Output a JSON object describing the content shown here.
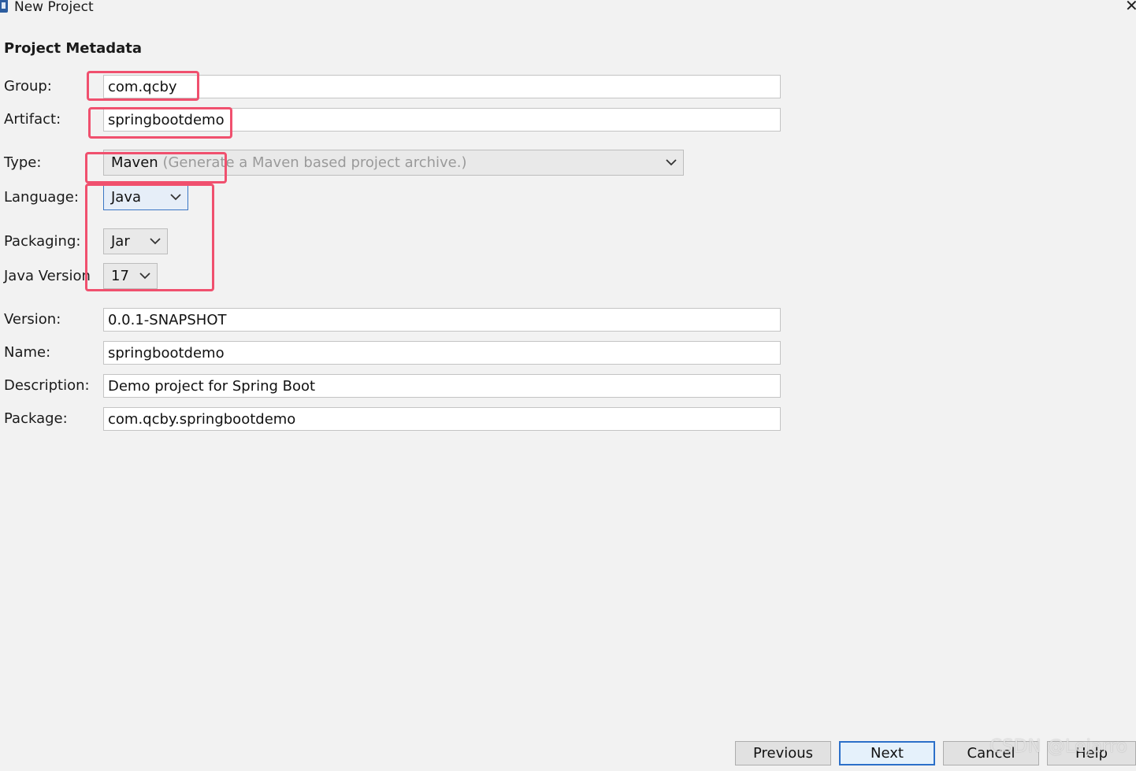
{
  "window": {
    "title": "New Project",
    "close_symbol": "✕"
  },
  "form": {
    "section_title": "Project Metadata",
    "group_label": "Group:",
    "group_value": "com.qcby",
    "artifact_label": "Artifact:",
    "artifact_value": "springbootdemo",
    "type_label": "Type:",
    "type_value": "Maven",
    "type_hint": "(Generate a Maven based project archive.)",
    "language_label": "Language:",
    "language_value": "Java",
    "packaging_label": "Packaging:",
    "packaging_value": "Jar",
    "java_version_label": "Java Version",
    "java_version_value": "17",
    "version_label": "Version:",
    "version_value": "0.0.1-SNAPSHOT",
    "name_label": "Name:",
    "name_value": "springbootdemo",
    "description_label": "Description:",
    "description_value": "Demo project for Spring Boot",
    "package_label": "Package:",
    "package_value": "com.qcby.springbootdemo"
  },
  "buttons": {
    "previous": "Previous",
    "next": "Next",
    "cancel": "Cancel",
    "help": "Help"
  },
  "watermark": "CSDN @Lejarro",
  "colors": {
    "highlight": "#f0506e",
    "primary_border": "#2c70c9"
  }
}
